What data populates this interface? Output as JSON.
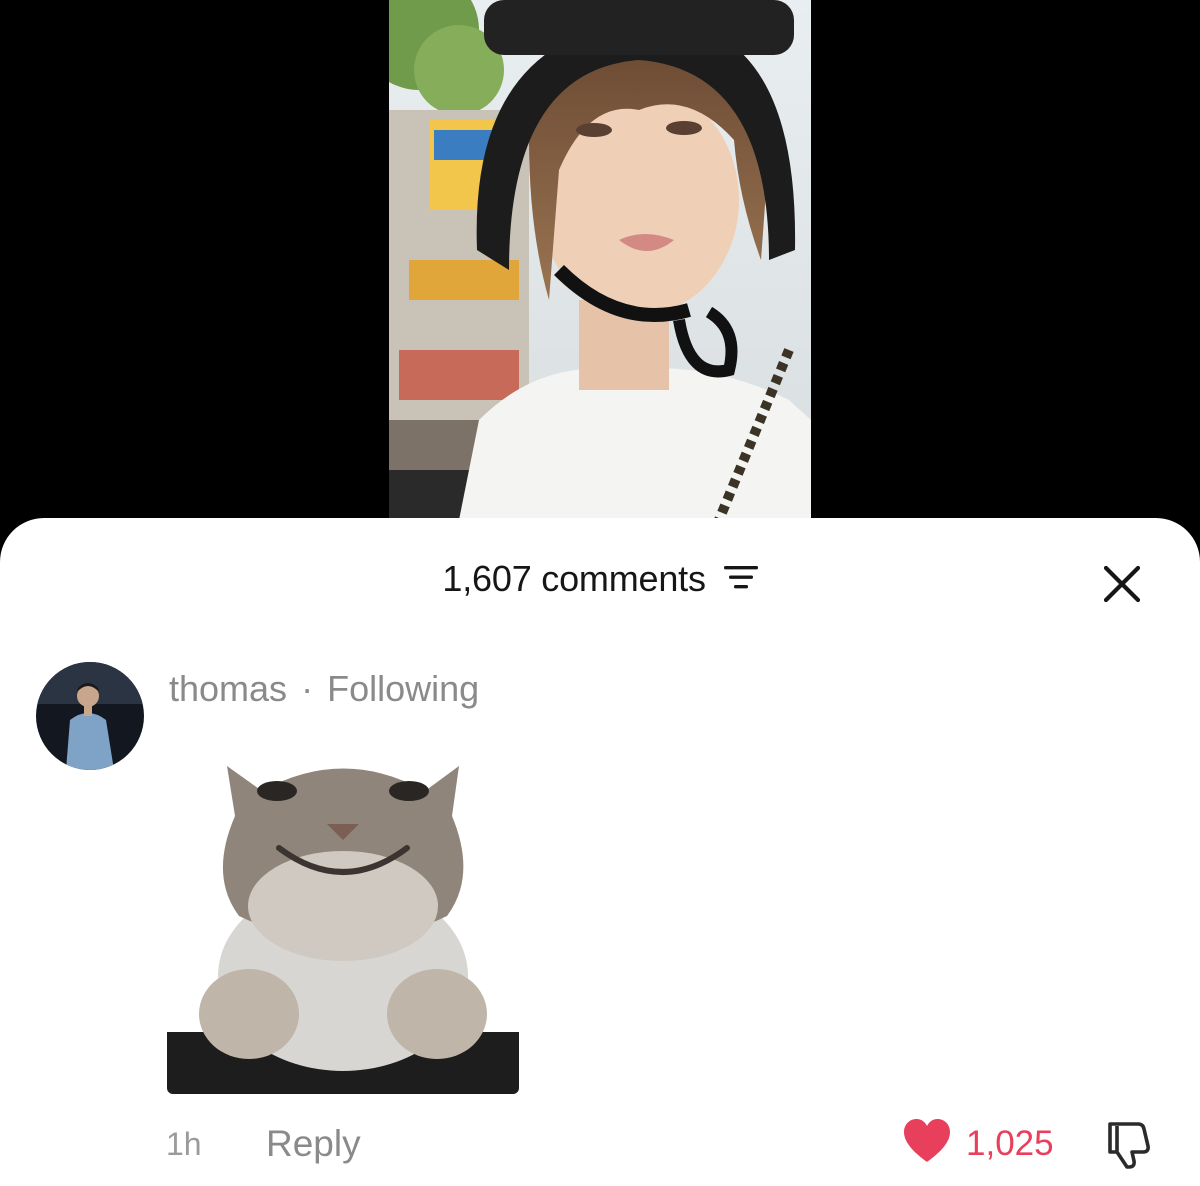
{
  "video": {},
  "comments_panel": {
    "count_label": "1,607 comments",
    "filter_icon": "filter-lines-icon",
    "close_icon": "close-icon"
  },
  "comment": {
    "username": "thomas",
    "separator": "·",
    "relationship": "Following",
    "sticker": "smiling-cat-sticker",
    "time": "1h",
    "reply_label": "Reply",
    "like_count": "1,025",
    "like_icon": "heart-icon",
    "dislike_icon": "thumbs-down-icon"
  },
  "colors": {
    "like_active": "#e8405c",
    "meta_text": "#8a8a8a",
    "sheet_bg": "#ffffff"
  }
}
